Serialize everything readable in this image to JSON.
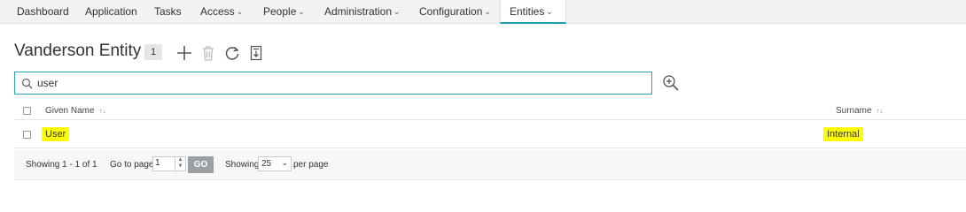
{
  "nav": {
    "items": [
      {
        "label": "Dashboard",
        "dropdown": false
      },
      {
        "label": "Application",
        "dropdown": false
      },
      {
        "label": "Tasks",
        "dropdown": false
      },
      {
        "label": "Access",
        "dropdown": true
      },
      {
        "label": "People",
        "dropdown": true
      },
      {
        "label": "Administration",
        "dropdown": true
      },
      {
        "label": "Configuration",
        "dropdown": true
      },
      {
        "label": "Entities",
        "dropdown": true,
        "active": true
      }
    ]
  },
  "header": {
    "title": "Vanderson Entity",
    "count": "1"
  },
  "toolbar": {
    "icons": [
      "add-icon",
      "delete-icon",
      "refresh-icon",
      "export-icon"
    ]
  },
  "search": {
    "value": "user",
    "placeholder": ""
  },
  "table": {
    "columns": [
      "Given Name",
      "Surname"
    ],
    "rows": [
      {
        "given_name": "User",
        "surname": "Internal"
      }
    ]
  },
  "footer": {
    "showing_text": "Showing 1 - 1 of 1",
    "goto_label": "Go to page",
    "page_value": "1",
    "go_label": "GO",
    "showing_label": "Showing",
    "per_page_value": "25",
    "per_page_label": "per page"
  },
  "colors": {
    "accent": "#1a9fb5",
    "highlight": "#ffff00",
    "go_button": "#999fa3"
  }
}
